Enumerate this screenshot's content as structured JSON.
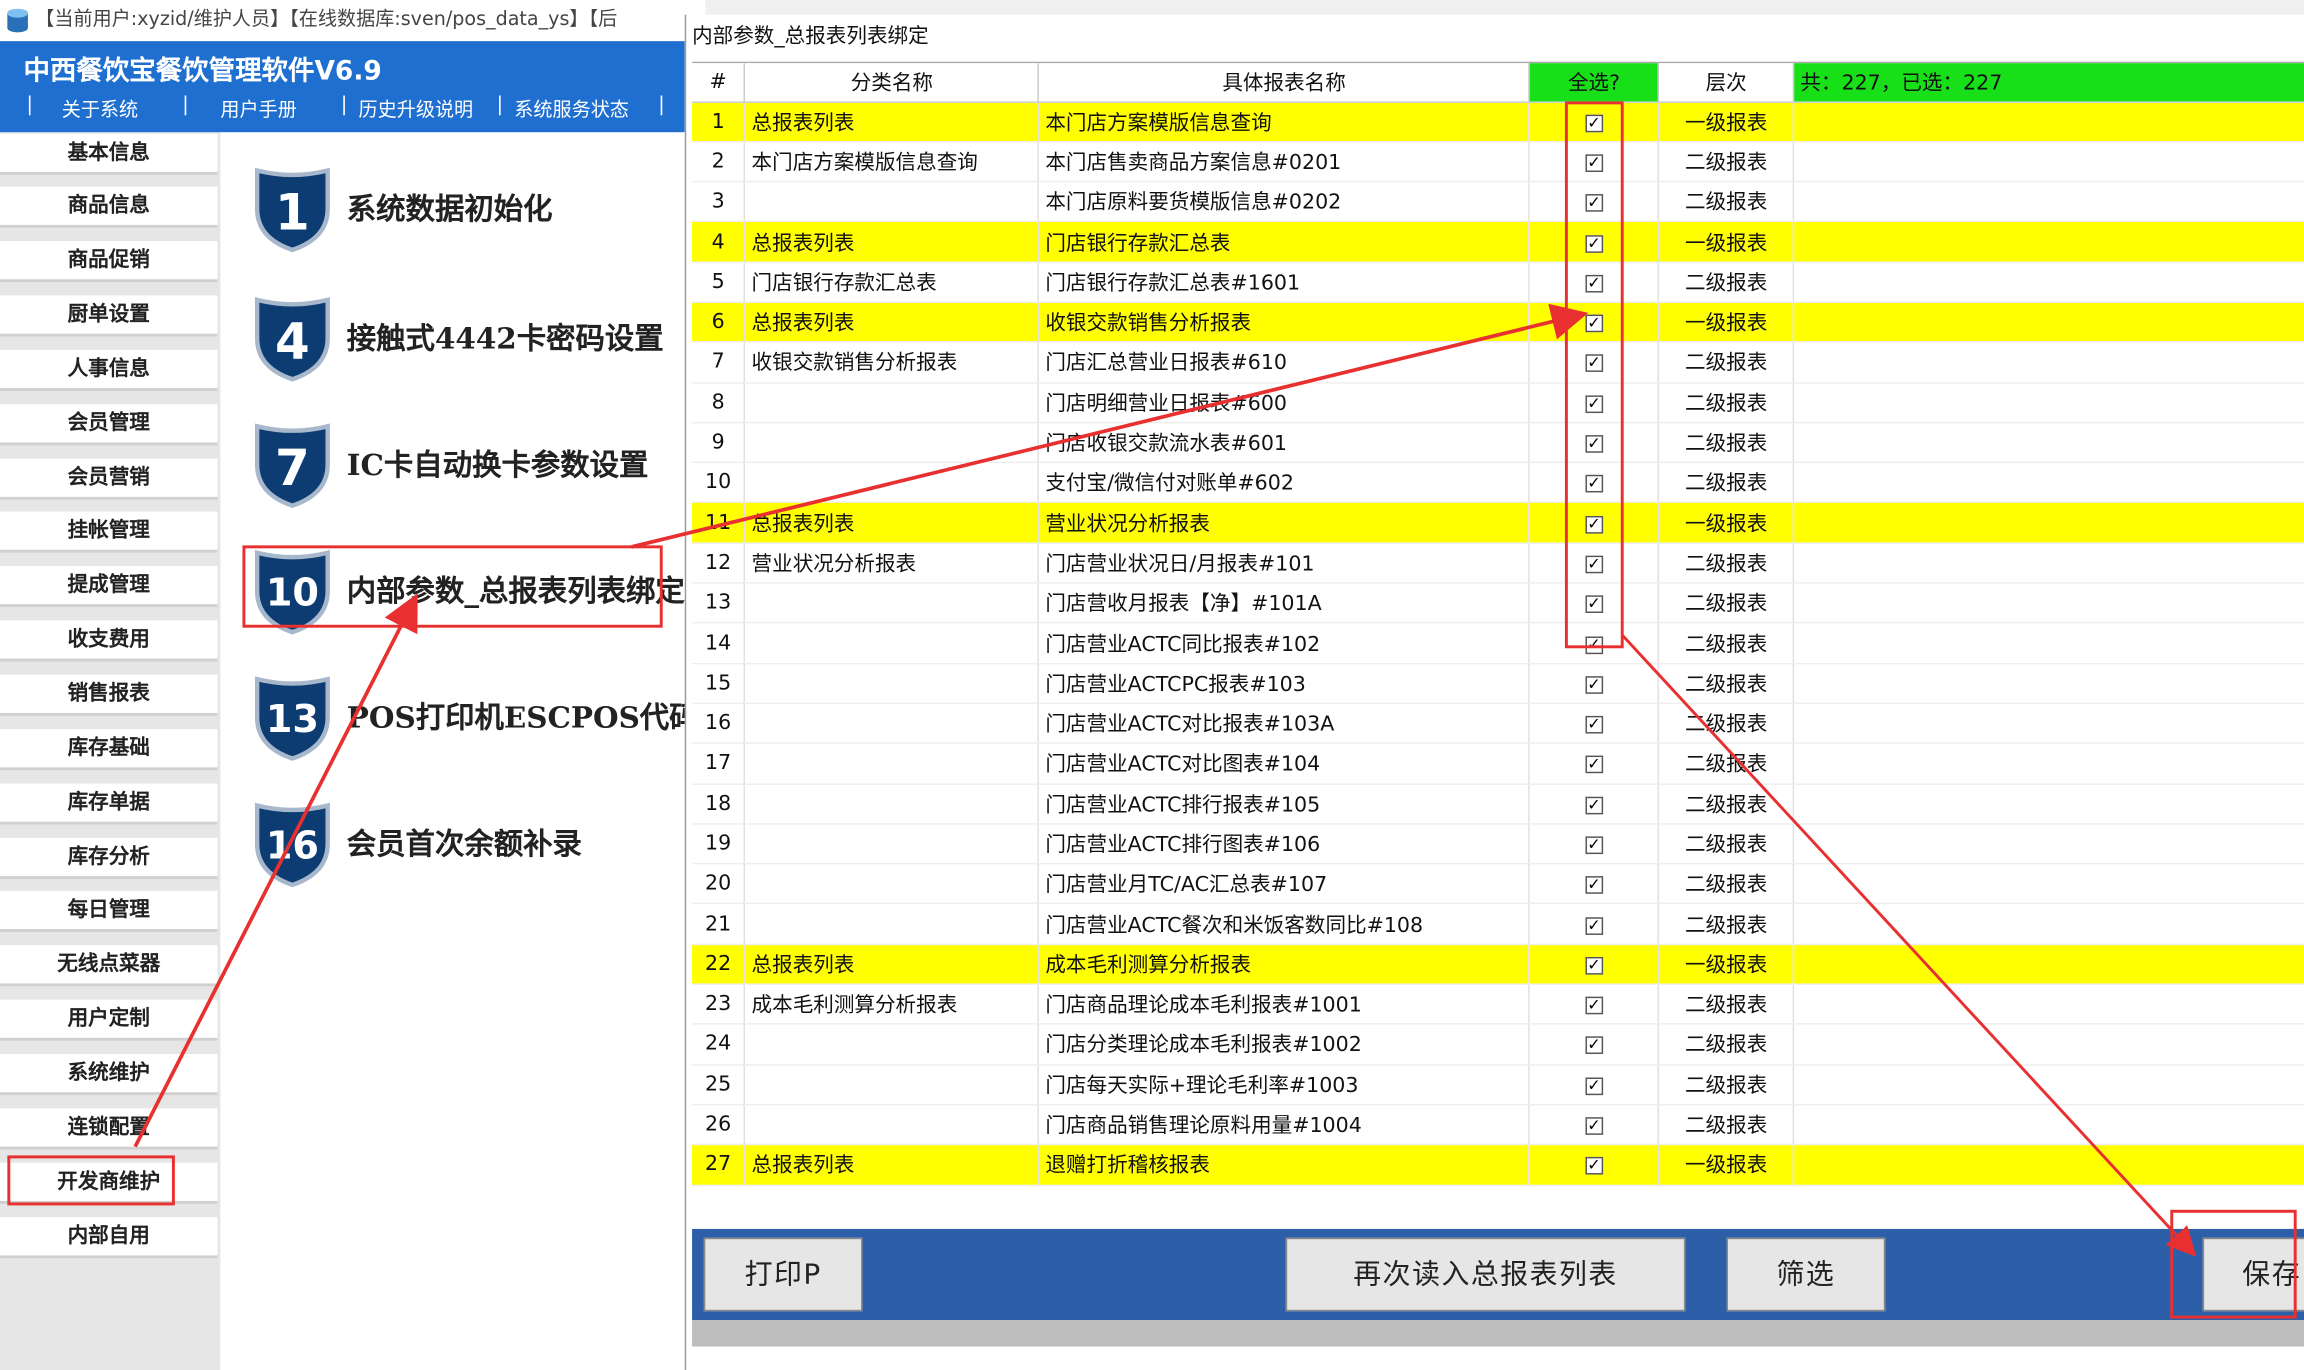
{
  "topbar": {
    "text": "【当前用户:xyzid/维护人员】【在线数据库:sven/pos_data_ys】【后"
  },
  "app": {
    "title": "中西餐饮宝餐饮管理软件V6.9"
  },
  "menu": {
    "items": [
      "关于系统",
      "用户手册",
      "历史升级说明",
      "系统服务状态"
    ],
    "separator": "|"
  },
  "sidebar": {
    "items": [
      "基本信息",
      "商品信息",
      "商品促销",
      "厨单设置",
      "人事信息",
      "会员管理",
      "会员营销",
      "挂帐管理",
      "提成管理",
      "收支费用",
      "销售报表",
      "库存基础",
      "库存单据",
      "库存分析",
      "每日管理",
      "无线点菜器",
      "用户定制",
      "系统维护",
      "连锁配置",
      "开发商维护",
      "内部自用"
    ],
    "selected": "开发商维护"
  },
  "functions": [
    {
      "num": "1",
      "label": "系统数据初始化"
    },
    {
      "num": "4",
      "label": "接触式4442卡密码设置"
    },
    {
      "num": "7",
      "label": "IC卡自动换卡参数设置"
    },
    {
      "num": "10",
      "label": "内部参数_总报表列表绑定"
    },
    {
      "num": "13",
      "label": "POS打印机ESCPOS代码表"
    },
    {
      "num": "16",
      "label": "会员首次余额补录"
    }
  ],
  "dialog": {
    "title": "内部参数_总报表列表绑定",
    "columns": {
      "num": "#",
      "category": "分类名称",
      "report": "具体报表名称",
      "select_all": "全选?",
      "level": "层次"
    },
    "stats": "共：227，已选：227",
    "check_mark": "✓",
    "rows": [
      {
        "n": "1",
        "cat": "总报表列表",
        "name": "本门店方案模版信息查询",
        "level": "一级报表"
      },
      {
        "n": "2",
        "cat": "本门店方案模版信息查询",
        "name": "本门店售卖商品方案信息#0201",
        "level": "二级报表"
      },
      {
        "n": "3",
        "cat": "",
        "name": "本门店原料要货模版信息#0202",
        "level": "二级报表"
      },
      {
        "n": "4",
        "cat": "总报表列表",
        "name": "门店银行存款汇总表",
        "level": "一级报表"
      },
      {
        "n": "5",
        "cat": "门店银行存款汇总表",
        "name": "门店银行存款汇总表#1601",
        "level": "二级报表"
      },
      {
        "n": "6",
        "cat": "总报表列表",
        "name": "收银交款销售分析报表",
        "level": "一级报表"
      },
      {
        "n": "7",
        "cat": "收银交款销售分析报表",
        "name": "门店汇总营业日报表#610",
        "level": "二级报表"
      },
      {
        "n": "8",
        "cat": "",
        "name": "门店明细营业日报表#600",
        "level": "二级报表"
      },
      {
        "n": "9",
        "cat": "",
        "name": "门店收银交款流水表#601",
        "level": "二级报表"
      },
      {
        "n": "10",
        "cat": "",
        "name": "支付宝/微信付对账单#602",
        "level": "二级报表"
      },
      {
        "n": "11",
        "cat": "总报表列表",
        "name": "营业状况分析报表",
        "level": "一级报表"
      },
      {
        "n": "12",
        "cat": "营业状况分析报表",
        "name": "门店营业状况日/月报表#101",
        "level": "二级报表"
      },
      {
        "n": "13",
        "cat": "",
        "name": "门店营收月报表【净】#101A",
        "level": "二级报表"
      },
      {
        "n": "14",
        "cat": "",
        "name": "门店营业ACTC同比报表#102",
        "level": "二级报表"
      },
      {
        "n": "15",
        "cat": "",
        "name": "门店营业ACTCPC报表#103",
        "level": "二级报表"
      },
      {
        "n": "16",
        "cat": "",
        "name": "门店营业ACTC对比报表#103A",
        "level": "二级报表"
      },
      {
        "n": "17",
        "cat": "",
        "name": "门店营业ACTC对比图表#104",
        "level": "二级报表"
      },
      {
        "n": "18",
        "cat": "",
        "name": "门店营业ACTC排行报表#105",
        "level": "二级报表"
      },
      {
        "n": "19",
        "cat": "",
        "name": "门店营业ACTC排行图表#106",
        "level": "二级报表"
      },
      {
        "n": "20",
        "cat": "",
        "name": "门店营业月TC/AC汇总表#107",
        "level": "二级报表"
      },
      {
        "n": "21",
        "cat": "",
        "name": "门店营业ACTC餐次和米饭客数同比#108",
        "level": "二级报表"
      },
      {
        "n": "22",
        "cat": "总报表列表",
        "name": "成本毛利测算分析报表",
        "level": "一级报表"
      },
      {
        "n": "23",
        "cat": "成本毛利测算分析报表",
        "name": "门店商品理论成本毛利报表#1001",
        "level": "二级报表"
      },
      {
        "n": "24",
        "cat": "",
        "name": "门店分类理论成本毛利报表#1002",
        "level": "二级报表"
      },
      {
        "n": "25",
        "cat": "",
        "name": "门店每天实际+理论毛利率#1003",
        "level": "二级报表"
      },
      {
        "n": "26",
        "cat": "",
        "name": "门店商品销售理论原料用量#1004",
        "level": "二级报表"
      },
      {
        "n": "27",
        "cat": "总报表列表",
        "name": "退赠打折稽核报表",
        "level": "一级报表"
      }
    ]
  },
  "buttons": {
    "print": "打印P",
    "reload": "再次读入总报表列表",
    "filter": "筛选",
    "save": "保存"
  },
  "colors": {
    "header_blue": "#1f6fd0",
    "highlight_yellow": "#ffff00",
    "select_green": "#18e018",
    "annotation_red": "#e83030",
    "button_bar": "#2c5fa8"
  }
}
